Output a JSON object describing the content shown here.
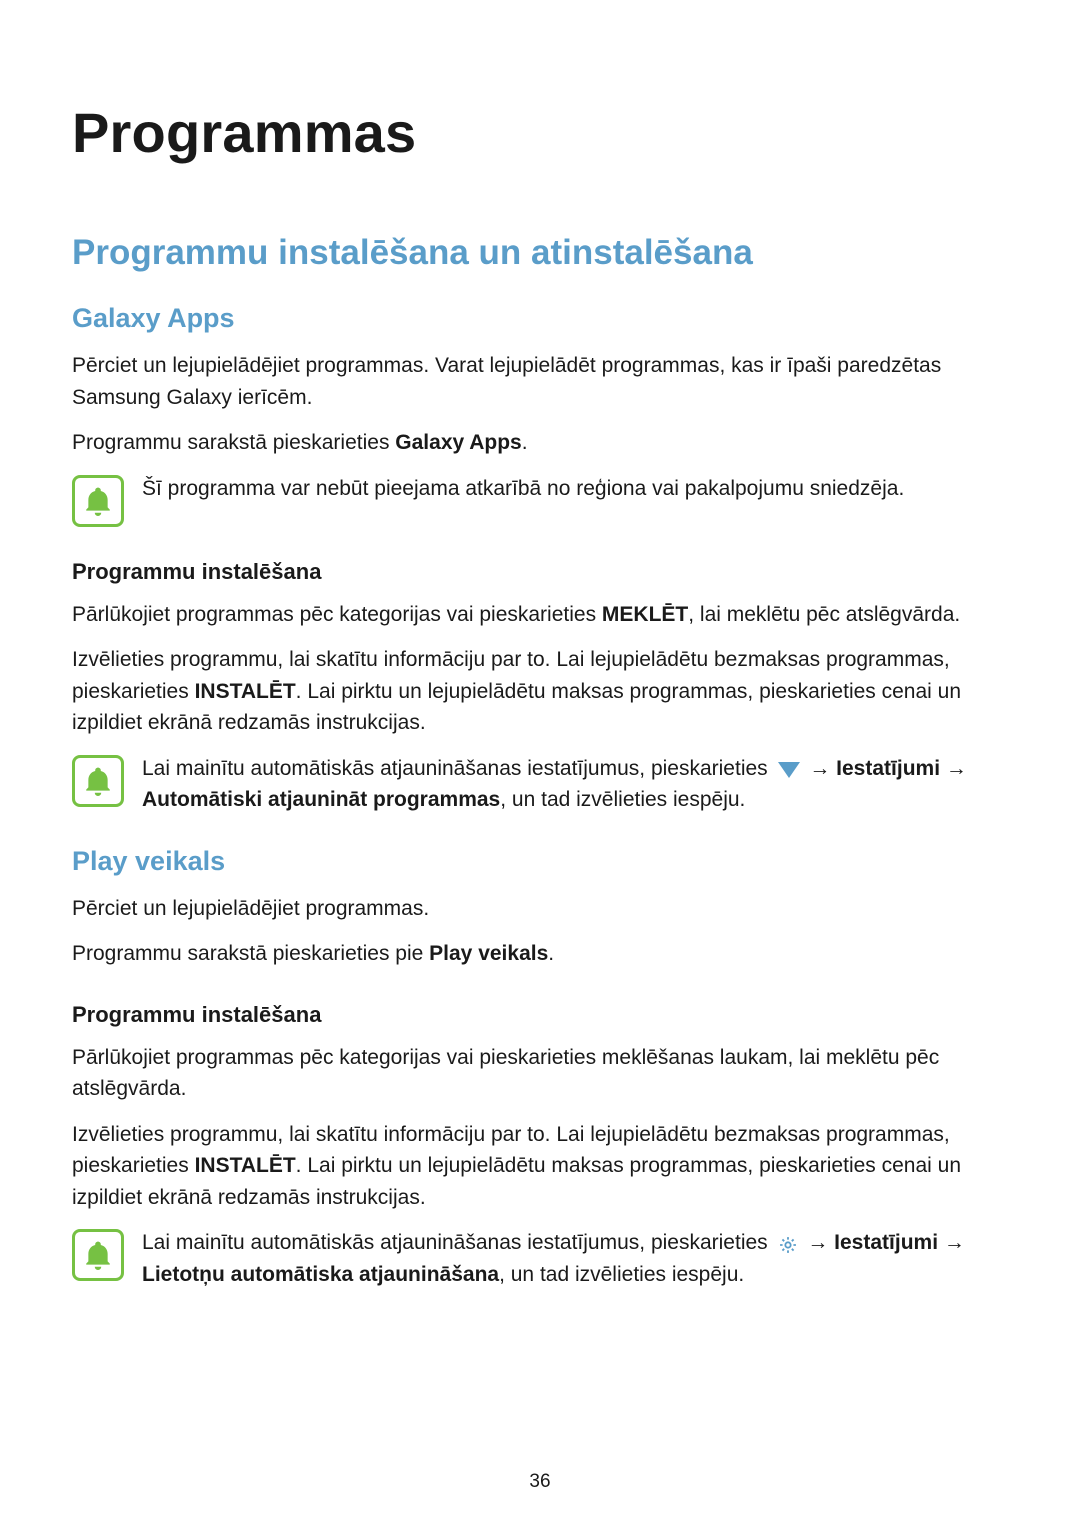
{
  "title_h1": "Programmas",
  "title_h2": "Programmu instalēšana un atinstalēšana",
  "galaxy": {
    "h3": "Galaxy Apps",
    "p1": "Pērciet un lejupielādējiet programmas. Varat lejupielādēt programmas, kas ir īpaši paredzētas Samsung Galaxy ierīcēm.",
    "p2_a": "Programmu sarakstā pieskarieties ",
    "p2_b": "Galaxy Apps",
    "p2_c": ".",
    "note": "Šī programma var nebūt pieejama atkarībā no reģiona vai pakalpojumu sniedzēja.",
    "install_h4": "Programmu instalēšana",
    "install_p1_a": "Pārlūkojiet programmas pēc kategorijas vai pieskarieties ",
    "install_p1_b": "MEKLĒT",
    "install_p1_c": ", lai meklētu pēc atslēgvārda.",
    "install_p2_a": "Izvēlieties programmu, lai skatītu informāciju par to. Lai lejupielādētu bezmaksas programmas, pieskarieties ",
    "install_p2_b": "INSTALĒT",
    "install_p2_c": ". Lai pirktu un lejupielādētu maksas programmas, pieskarieties cenai un izpildiet ekrānā redzamās instrukcijas.",
    "note2_a": "Lai mainītu automātiskās atjaunināšanas iestatījumus, pieskarieties ",
    "note2_arrow": " → ",
    "note2_b": "Iestatījumi",
    "note2_c": " → ",
    "note2_d": "Automātiski atjaunināt programmas",
    "note2_e": ", un tad izvēlieties iespēju."
  },
  "play": {
    "h3": "Play veikals",
    "p1": "Pērciet un lejupielādējiet programmas.",
    "p2_a": "Programmu sarakstā pieskarieties pie ",
    "p2_b": "Play veikals",
    "p2_c": ".",
    "install_h4": "Programmu instalēšana",
    "install_p1": "Pārlūkojiet programmas pēc kategorijas vai pieskarieties meklēšanas laukam, lai meklētu pēc atslēgvārda.",
    "install_p2_a": "Izvēlieties programmu, lai skatītu informāciju par to. Lai lejupielādētu bezmaksas programmas, pieskarieties ",
    "install_p2_b": "INSTALĒT",
    "install_p2_c": ". Lai pirktu un lejupielādētu maksas programmas, pieskarieties cenai un izpildiet ekrānā redzamās instrukcijas.",
    "note_a": "Lai mainītu automātiskās atjaunināšanas iestatījumus, pieskarieties ",
    "note_arrow": " → ",
    "note_b": "Iestatījumi",
    "note_c": " → ",
    "note_d": "Lietotņu automātiska atjaunināšana",
    "note_e": ", un tad izvēlieties iespēju."
  },
  "page_number": "36"
}
